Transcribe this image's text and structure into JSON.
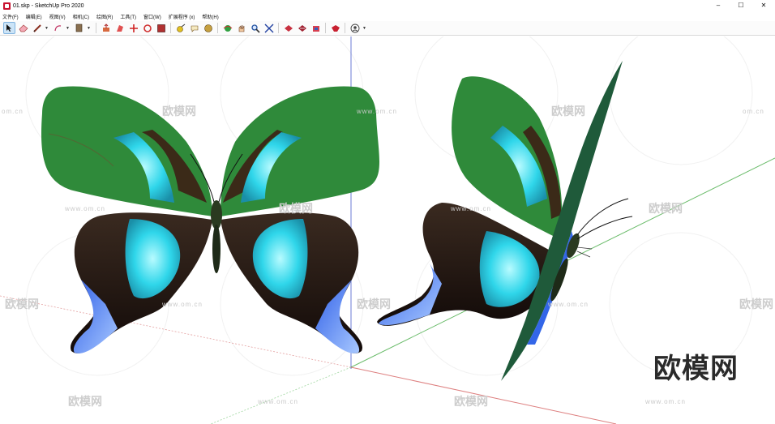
{
  "window": {
    "title": "01.skp - SketchUp Pro 2020",
    "controls": {
      "minimize": "–",
      "maximize": "☐",
      "close": "✕"
    }
  },
  "menu": [
    "文件(F)",
    "编辑(E)",
    "视图(V)",
    "相机(C)",
    "绘图(R)",
    "工具(T)",
    "窗口(W)",
    "扩展程序 (x)",
    "帮助(H)"
  ],
  "toolbar": {
    "icons": [
      "select-arrow",
      "eraser",
      "pencil-line",
      "freehand-arc",
      "paint-bucket",
      "push-pull",
      "follow-me",
      "move",
      "rotate",
      "scale",
      "offset",
      "tape-measure",
      "text-label",
      "dimension",
      "orbit",
      "pan",
      "zoom",
      "zoom-extents",
      "section-plane",
      "components",
      "warehouse",
      "extension-warehouse",
      "user-account"
    ]
  },
  "watermark": {
    "url": "www.om.cn",
    "url_alt": "om.cn",
    "brand": "欧模网"
  },
  "colors": {
    "red_axis": "#d04a4a",
    "green_axis": "#2da02d",
    "blue_axis": "#3a50c8",
    "wing_green": "#2f8a3a",
    "wing_cyan": "#28d4e6",
    "wing_dark": "#2a1a12",
    "wing_blue": "#3366e8"
  }
}
